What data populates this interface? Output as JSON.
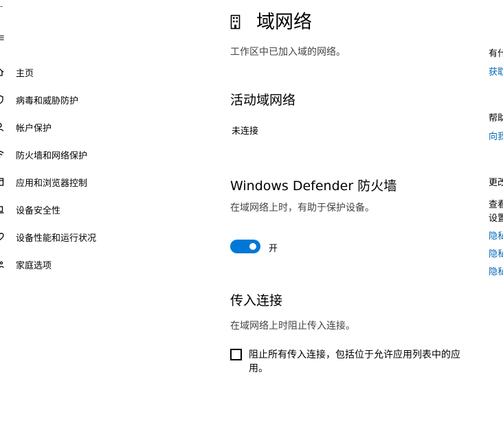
{
  "sidebar": {
    "top_fragments": [
      "-",
      "≡"
    ],
    "items": [
      {
        "label": "主页",
        "icon": "home-icon"
      },
      {
        "label": "病毒和威胁防护",
        "icon": "shield-icon"
      },
      {
        "label": "帐户保护",
        "icon": "person-icon"
      },
      {
        "label": "防火墙和网络保护",
        "icon": "wifi-icon"
      },
      {
        "label": "应用和浏览器控制",
        "icon": "app-window-icon"
      },
      {
        "label": "设备安全性",
        "icon": "laptop-icon"
      },
      {
        "label": "设备性能和运行状况",
        "icon": "heart-icon"
      },
      {
        "label": "家庭选项",
        "icon": "family-icon"
      }
    ]
  },
  "main": {
    "title": "域网络",
    "title_icon": "building-icon",
    "description": "工作区中已加入域的网络。",
    "active_network": {
      "heading": "活动域网络",
      "value": "未连接"
    },
    "firewall": {
      "heading": "Windows Defender 防火墙",
      "description": "在域网络上时，有助于保护设备。",
      "toggle_label": "开"
    },
    "incoming": {
      "heading": "传入连接",
      "description": "在域网络上时阻止传入连接。",
      "checkbox_label": "阻止所有传入连接，包括位于允许应用列表中的应用。"
    }
  },
  "right_panel": {
    "question_title": "有什",
    "question_link": "获取",
    "help_title": "帮助",
    "help_link": "向我",
    "change_title": "更改",
    "change_line1": "查看",
    "change_line2": "设置",
    "privacy_links": [
      "隐私",
      "隐私",
      "隐私"
    ]
  },
  "colors": {
    "accent": "#0078d7",
    "link": "#0067b8",
    "background": "#ffffff"
  }
}
